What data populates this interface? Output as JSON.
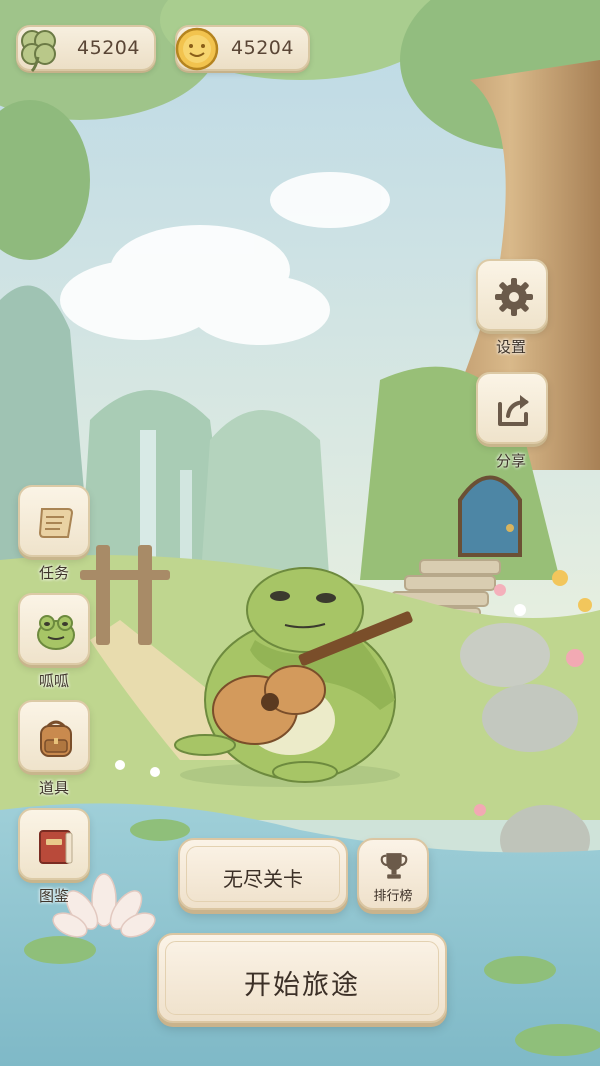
{
  "currency": {
    "clover_count": "45204",
    "coin_count": "45204"
  },
  "right_menu": {
    "settings_label": "设置",
    "share_label": "分享"
  },
  "left_menu": {
    "tasks_label": "任务",
    "frog_label": "呱呱",
    "items_label": "道具",
    "collection_label": "图鉴"
  },
  "buttons": {
    "endless_label": "无尽关卡",
    "leaderboard_label": "排行榜",
    "start_label": "开始旅途"
  },
  "colors": {
    "panel": "#f4ead8",
    "panel_border": "#dbc6a2",
    "text": "#3c3027",
    "frog_green": "#a7c566"
  }
}
